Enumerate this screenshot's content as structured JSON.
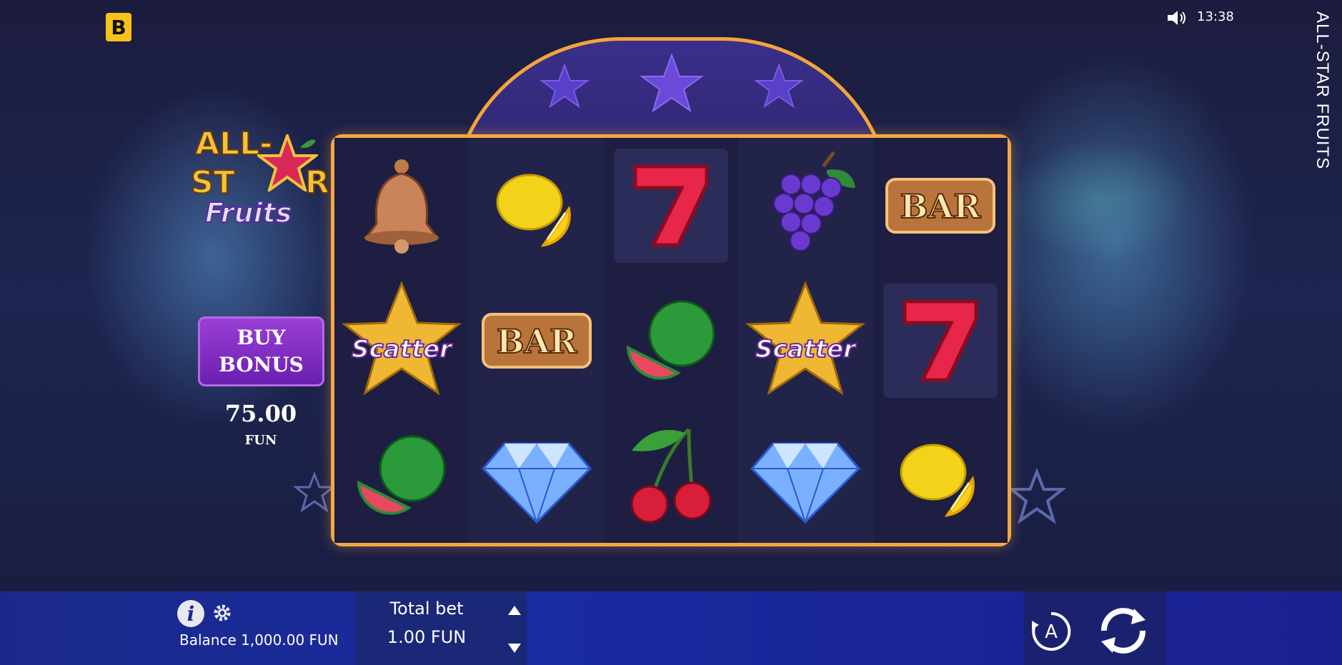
{
  "top": {
    "brand_letter": "B",
    "clock": "13:38",
    "vertical_title": "ALL-STAR FRUITS"
  },
  "logo": {
    "line1": "ALL-",
    "line2_a": "ST",
    "line2_b": "R",
    "line3": "Fruits"
  },
  "buy_bonus": {
    "label": "BUY\nBONUS",
    "price": "75.00",
    "currency": "FUN"
  },
  "reels": {
    "symbols": [
      "bell",
      "lemon",
      "seven",
      "grapes",
      "bar",
      "scatter",
      "bar",
      "watermelon",
      "scatter",
      "seven",
      "watermelon",
      "diamond",
      "cherry",
      "diamond",
      "lemon"
    ],
    "bar_text": "BAR",
    "scatter_text": "Scatter"
  },
  "bottom": {
    "balance": "Balance 1,000.00 FUN",
    "bet_label": "Total bet",
    "bet_value": "1.00 FUN",
    "auto_letter": "A"
  },
  "icons": {
    "info": "info-icon",
    "settings": "gear-icon",
    "sound": "speaker-icon",
    "spin": "spin-icon",
    "autoplay": "autoplay-icon"
  },
  "colors": {
    "frame": "#f5a740",
    "brand": "#f7c21a",
    "buy_bonus": "#8a34c8",
    "bottom_bar": "#1b2a8a"
  }
}
